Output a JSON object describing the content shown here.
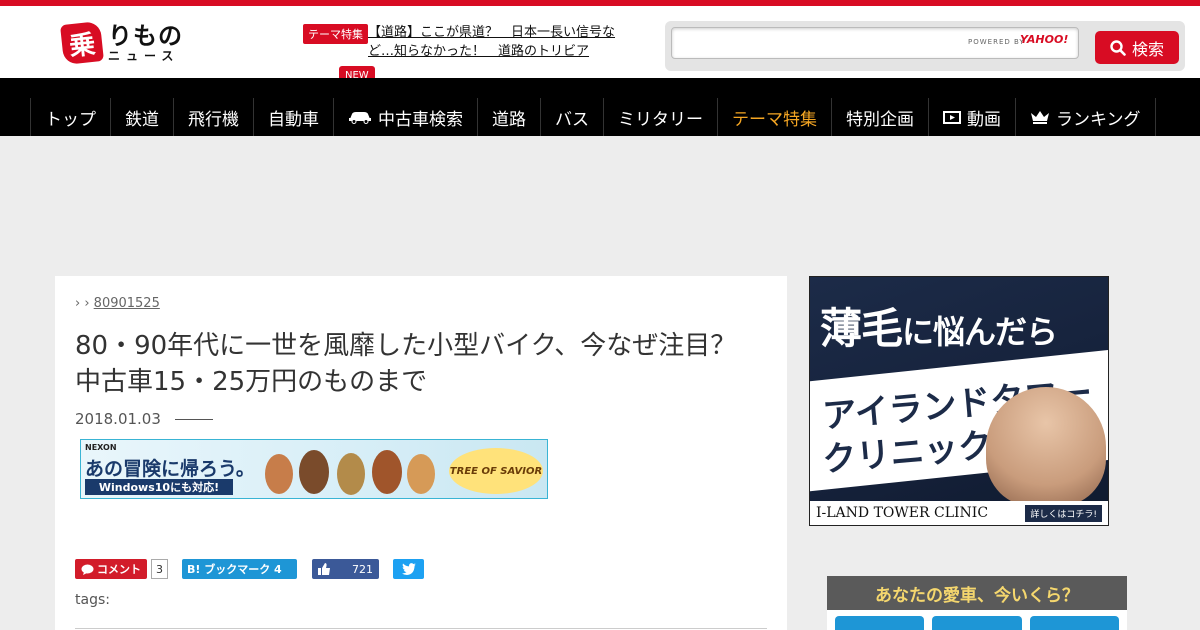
{
  "header": {
    "logo": {
      "mark": "乗",
      "line1": "りもの",
      "line2": "ニュース"
    },
    "theme_badge": "テーマ特集",
    "theme_link": "【道路】ここが県道？　日本一長い信号など…知らなかった！　道路のトリビア",
    "new_badge": "NEW",
    "search": {
      "placeholder": "",
      "powered": "POWERED BY",
      "provider": "YAHOO!",
      "button": "検索"
    }
  },
  "nav": {
    "items": [
      {
        "label": "トップ",
        "icon": null
      },
      {
        "label": "鉄道",
        "icon": null
      },
      {
        "label": "飛行機",
        "icon": null
      },
      {
        "label": "自動車",
        "icon": null
      },
      {
        "label": "中古車検索",
        "icon": "car-icon"
      },
      {
        "label": "道路",
        "icon": null
      },
      {
        "label": "バス",
        "icon": null
      },
      {
        "label": "ミリタリー",
        "icon": null
      },
      {
        "label": "テーマ特集",
        "icon": null,
        "highlight": true
      },
      {
        "label": "特別企画",
        "icon": null
      },
      {
        "label": "動画",
        "icon": "video-icon"
      },
      {
        "label": "ランキング",
        "icon": "crown-icon"
      }
    ],
    "highlight_color": "#f5a623"
  },
  "article": {
    "breadcrumb": {
      "sep": "› ›",
      "current": "80901525"
    },
    "title": "80・90年代に一世を風靡した小型バイク、今なぜ注目？　中古車15・25万円のものまで",
    "date": "2018.01.03",
    "banner": {
      "brand": "NEXON",
      "slogan": "あの冒険に帰ろう。",
      "sub": "Windows10にも対応!",
      "game": "TREE OF SAVIOR"
    },
    "share": {
      "comment_label": "コメント",
      "comment_count": "3",
      "hatena_label": "B! ブックマーク 4",
      "fb_count": "721"
    },
    "tags_label": "tags:"
  },
  "sidebar": {
    "ad1": {
      "headline_a": "薄毛",
      "headline_b": "に悩んだら",
      "clinic_line1": "アイランドタワー",
      "clinic_line2": "クリニック",
      "name": "I-LAND TOWER CLINIC",
      "cta": "詳しくはコチラ!"
    },
    "ad2": {
      "headline": "あなたの愛車、今いくら？"
    }
  },
  "colors": {
    "brand": "#d80c23",
    "nav_bg": "#000000",
    "page_bg": "#ededed"
  }
}
